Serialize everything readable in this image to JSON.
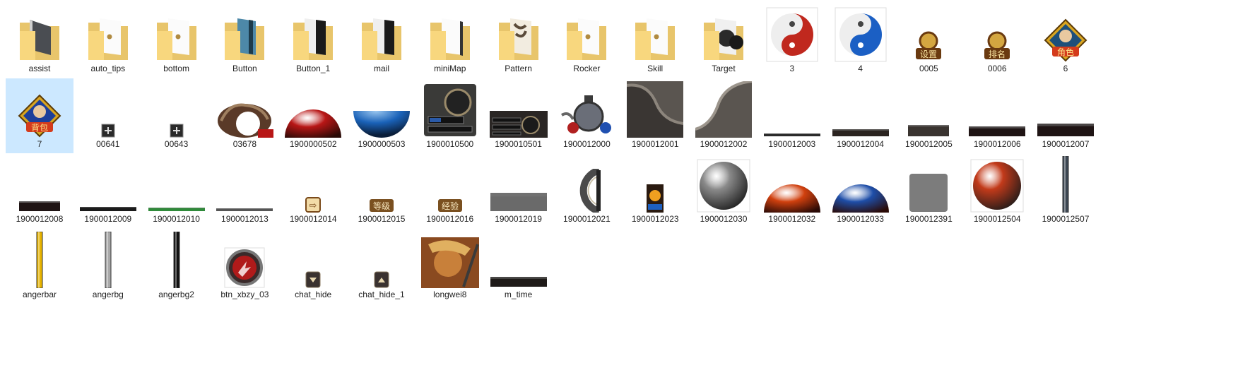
{
  "window": {
    "view": "large-icons"
  },
  "selected_index": 16,
  "items": [
    {
      "name": "assist",
      "kind": "folder",
      "icon": "folder-icon",
      "content": "dark-slate"
    },
    {
      "name": "auto_tips",
      "kind": "folder",
      "icon": "folder-icon",
      "content": "white-dot"
    },
    {
      "name": "bottom",
      "kind": "folder",
      "icon": "folder-icon",
      "content": "white-dot"
    },
    {
      "name": "Button",
      "kind": "folder",
      "icon": "folder-icon",
      "content": "blue-panel"
    },
    {
      "name": "Button_1",
      "kind": "folder",
      "icon": "folder-icon",
      "content": "dark-panel"
    },
    {
      "name": "mail",
      "kind": "folder",
      "icon": "folder-icon",
      "content": "dark-panel"
    },
    {
      "name": "miniMap",
      "kind": "folder",
      "icon": "folder-icon",
      "content": "white-doc"
    },
    {
      "name": "Pattern",
      "kind": "folder",
      "icon": "folder-icon",
      "content": "calligraphy"
    },
    {
      "name": "Rocker",
      "kind": "folder",
      "icon": "folder-icon",
      "content": "white-dot"
    },
    {
      "name": "Skill",
      "kind": "folder",
      "icon": "folder-icon",
      "content": "white-dot"
    },
    {
      "name": "Target",
      "kind": "folder",
      "icon": "folder-icon",
      "content": "mask"
    },
    {
      "name": "3",
      "kind": "image",
      "icon": "yin-yang-red-icon",
      "shape": "yinyang",
      "color": "#c0281e"
    },
    {
      "name": "4",
      "kind": "image",
      "icon": "yin-yang-blue-icon",
      "shape": "yinyang",
      "color": "#1b5fc4"
    },
    {
      "name": "0005",
      "kind": "image",
      "icon": "settings-badge-icon",
      "shape": "badge",
      "text": "设置",
      "color": "#6a3a10"
    },
    {
      "name": "0006",
      "kind": "image",
      "icon": "ranking-badge-icon",
      "shape": "badge",
      "text": "排名",
      "color": "#6a3a10"
    },
    {
      "name": "6",
      "kind": "image",
      "icon": "character-portrait-icon",
      "shape": "diamond-portrait",
      "text": "角色",
      "color": "#1d4f7a"
    },
    {
      "name": "7",
      "kind": "image",
      "icon": "backpack-portrait-icon",
      "shape": "diamond-portrait",
      "text": "背包",
      "color": "#1d3f9a"
    },
    {
      "name": "00641",
      "kind": "image",
      "icon": "plus-box-icon",
      "shape": "small-box"
    },
    {
      "name": "00643",
      "kind": "image",
      "icon": "plus-box-icon",
      "shape": "small-box"
    },
    {
      "name": "03678",
      "kind": "image",
      "icon": "dragon-ring-icon",
      "shape": "dragon-ring"
    },
    {
      "name": "1900000502",
      "kind": "image",
      "icon": "red-orb-half-icon",
      "shape": "half-orb-top",
      "color": "#b81616"
    },
    {
      "name": "1900000503",
      "kind": "image",
      "icon": "blue-orb-half-icon",
      "shape": "half-orb-bottom",
      "color": "#1a62b8"
    },
    {
      "name": "1900010500",
      "kind": "image",
      "icon": "ornate-panel-icon",
      "shape": "ornate-panel"
    },
    {
      "name": "1900010501",
      "kind": "image",
      "icon": "status-bar-panel-icon",
      "shape": "status-panel"
    },
    {
      "name": "1900012000",
      "kind": "image",
      "icon": "orb-frame-icon",
      "shape": "orb-frame"
    },
    {
      "name": "1900012001",
      "kind": "image",
      "icon": "stone-arch-left-icon",
      "shape": "stone-arch-left"
    },
    {
      "name": "1900012002",
      "kind": "image",
      "icon": "stone-arch-right-icon",
      "shape": "stone-arch-right"
    },
    {
      "name": "1900012003",
      "kind": "image",
      "icon": "thin-bar-icon",
      "shape": "bar",
      "h": 4,
      "color": "#2a2a2a"
    },
    {
      "name": "1900012004",
      "kind": "image",
      "icon": "bar-icon",
      "shape": "bar",
      "h": 10,
      "color": "#2b2420"
    },
    {
      "name": "1900012005",
      "kind": "image",
      "icon": "bar-icon",
      "shape": "bar-short",
      "h": 16,
      "color": "#3a3430"
    },
    {
      "name": "1900012006",
      "kind": "image",
      "icon": "bar-icon",
      "shape": "bar",
      "h": 14,
      "color": "#1f1414"
    },
    {
      "name": "1900012007",
      "kind": "image",
      "icon": "bar-icon",
      "shape": "bar",
      "h": 18,
      "color": "#1f1414"
    },
    {
      "name": "1900012008",
      "kind": "image",
      "icon": "bar-icon",
      "shape": "bar-short",
      "h": 14,
      "color": "#1f1414"
    },
    {
      "name": "1900012009",
      "kind": "image",
      "icon": "thin-bar-icon",
      "shape": "bar",
      "h": 6,
      "color": "#1a1a1a"
    },
    {
      "name": "1900012010",
      "kind": "image",
      "icon": "green-bar-icon",
      "shape": "bar",
      "h": 5,
      "color": "#2f8a3a"
    },
    {
      "name": "1900012013",
      "kind": "image",
      "icon": "thin-bar-icon",
      "shape": "bar",
      "h": 4,
      "color": "#555555"
    },
    {
      "name": "1900012014",
      "kind": "image",
      "icon": "arrow-badge-icon",
      "shape": "mini-badge",
      "text": "⇨",
      "color": "#7a4a1a"
    },
    {
      "name": "1900012015",
      "kind": "image",
      "icon": "level-label-icon",
      "shape": "mini-label",
      "text": "等级",
      "color": "#7a5020"
    },
    {
      "name": "1900012016",
      "kind": "image",
      "icon": "exp-label-icon",
      "shape": "mini-label",
      "text": "经验",
      "color": "#7a5020"
    },
    {
      "name": "1900012019",
      "kind": "image",
      "icon": "gray-bar-icon",
      "shape": "bar",
      "h": 26,
      "color": "#6a6a6a"
    },
    {
      "name": "1900012021",
      "kind": "image",
      "icon": "half-ring-frame-icon",
      "shape": "half-ring"
    },
    {
      "name": "1900012023",
      "kind": "image",
      "icon": "sun-card-icon",
      "shape": "sun-card"
    },
    {
      "name": "1900012030",
      "kind": "image",
      "icon": "silver-orb-icon",
      "shape": "orb",
      "color": "#8a8a8a"
    },
    {
      "name": "1900012032",
      "kind": "image",
      "icon": "orange-orb-half-icon",
      "shape": "half-orb-top",
      "color": "#d0400e"
    },
    {
      "name": "1900012033",
      "kind": "image",
      "icon": "fire-water-orb-half-icon",
      "shape": "half-orb-top",
      "color": "#1e4ea8"
    },
    {
      "name": "1900012391",
      "kind": "image",
      "icon": "gray-square-icon",
      "shape": "square",
      "color": "#7c7c7c"
    },
    {
      "name": "1900012504",
      "kind": "image",
      "icon": "red-orb-icon",
      "shape": "orb",
      "color": "#c23a1a"
    },
    {
      "name": "1900012507",
      "kind": "image",
      "icon": "vertical-bar-icon",
      "shape": "vbar",
      "color": "#3c4652"
    },
    {
      "name": "angerbar",
      "kind": "image",
      "icon": "gold-vertical-bar-icon",
      "shape": "vbar",
      "color": "#e8b400"
    },
    {
      "name": "angerbg",
      "kind": "image",
      "icon": "silver-vertical-bar-icon",
      "shape": "vbar",
      "color": "#a8a8a8"
    },
    {
      "name": "angerbg2",
      "kind": "image",
      "icon": "black-vertical-bar-icon",
      "shape": "vbar",
      "color": "#111111"
    },
    {
      "name": "btn_xbzy_03",
      "kind": "image",
      "icon": "skill-button-icon",
      "shape": "skill-btn"
    },
    {
      "name": "chat_hide",
      "kind": "image",
      "icon": "arrow-down-button-icon",
      "shape": "arrow-btn",
      "dir": "down"
    },
    {
      "name": "chat_hide_1",
      "kind": "image",
      "icon": "arrow-up-button-icon",
      "shape": "arrow-btn",
      "dir": "up"
    },
    {
      "name": "longwei8",
      "kind": "image",
      "icon": "warrior-portrait-icon",
      "shape": "warrior"
    },
    {
      "name": "m_time",
      "kind": "image",
      "icon": "time-bar-icon",
      "shape": "bar",
      "h": 14,
      "color": "#1e1a18"
    }
  ]
}
